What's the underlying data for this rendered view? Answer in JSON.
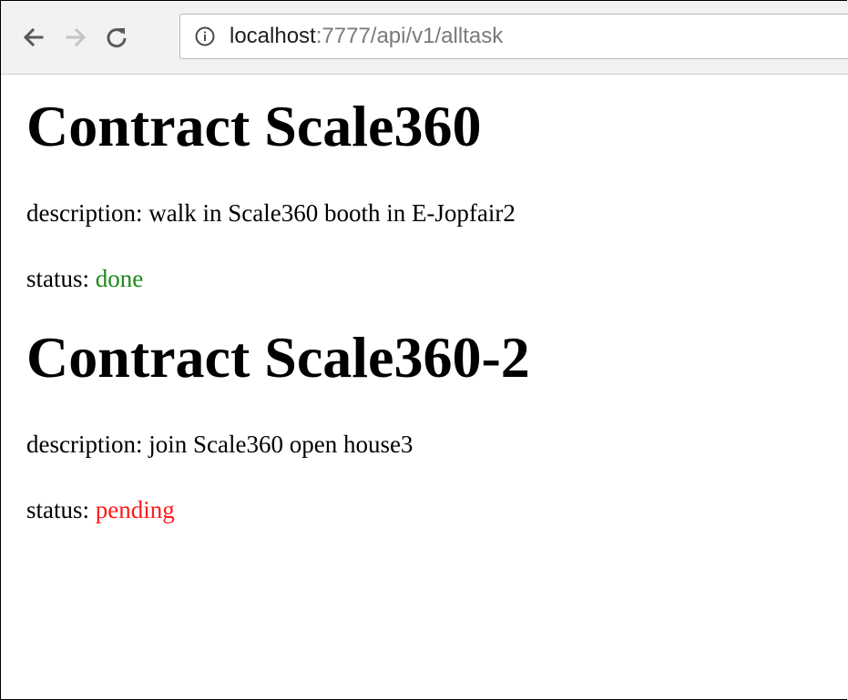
{
  "browser": {
    "url_host": "localhost",
    "url_path": ":7777/api/v1/alltask",
    "back_icon": "arrow-left-icon",
    "forward_icon": "arrow-right-icon",
    "reload_icon": "reload-icon",
    "info_icon": "info-icon"
  },
  "colors": {
    "done": "#1a8a1a",
    "pending": "#ff1a1a"
  },
  "tasks": [
    {
      "title": "Contract Scale360",
      "description_label": "description: ",
      "description": "walk in Scale360 booth in E-Jopfair2",
      "status_label": "status: ",
      "status": "done"
    },
    {
      "title": "Contract Scale360-2",
      "description_label": "description: ",
      "description": "join Scale360 open house3",
      "status_label": "status: ",
      "status": "pending"
    }
  ]
}
